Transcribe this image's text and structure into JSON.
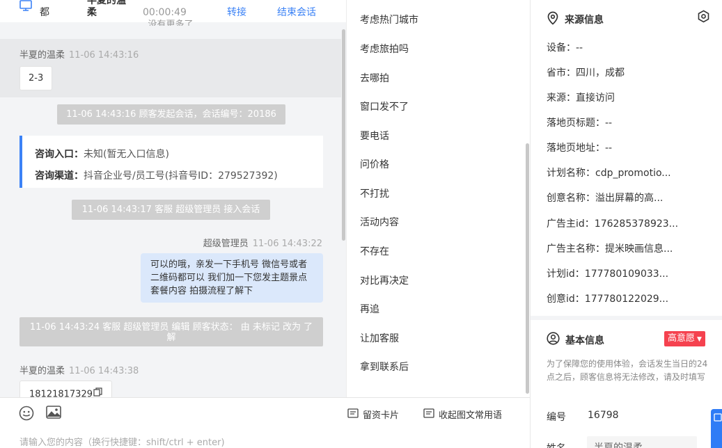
{
  "header": {
    "name_a": "都",
    "name_b_line1": "半夏的温",
    "name_b_line2": "柔",
    "timer": "00:00:49",
    "transfer_label": "转接",
    "end_label": "结束会话"
  },
  "chat": {
    "no_more": "没有更多了",
    "messages": [
      {
        "sender": "半夏的温柔",
        "time": "11-06 14:43:16",
        "text": "2-3"
      },
      {
        "sender": "半夏的温柔",
        "time": "11-06 14:43:38",
        "text": "18121817329"
      }
    ],
    "system": [
      "11-06 14:43:16 顾客发起会话，会话编号：20186",
      "11-06 14:43:17 客服 超级管理员 接入会话",
      "11-06 14:43:24 客服 超级管理员 编辑 顾客状态： 由 未标记 改为 了解"
    ],
    "info_card": {
      "entry_label": "咨询入口：",
      "entry_value": "未知(暂无入口信息)",
      "channel_label": "咨询渠道：",
      "channel_value": "抖音企业号/员工号(抖音号ID：279527392)"
    },
    "agent_reply": {
      "sender": "超级管理员",
      "time": "11-06 14:43:22",
      "text": "可以的哦，亲发一下手机号 微信号或者二维码都可以 我们加一下您发主题景点 套餐内容 拍摄流程了解下"
    }
  },
  "toolbar": {
    "card_label": "留资卡片",
    "collapse_label": "收起图文常用语",
    "input_placeholder": "请输入您的内容（换行快捷键：shift/ctrl + enter)"
  },
  "phrases": [
    "考虑热门城市",
    "考虑旅拍吗",
    "去哪拍",
    "窗口发不了",
    "要电话",
    "问价格",
    "不打扰",
    "活动内容",
    "不存在",
    "对比再决定",
    "再追",
    "让加客服",
    "拿到联系后"
  ],
  "source_info": {
    "title": "来源信息",
    "rows": [
      {
        "label": "设备：",
        "value": "--"
      },
      {
        "label": "省市：",
        "value": "四川，成都"
      },
      {
        "label": "来源：",
        "value": "直接访问"
      },
      {
        "label": "落地页标题：",
        "value": "--"
      },
      {
        "label": "落地页地址：",
        "value": "--"
      },
      {
        "label": "计划名称：",
        "value": "cdp_promotio..."
      },
      {
        "label": "创意名称：",
        "value": "溢出屏幕的高..."
      },
      {
        "label": "广告主id：",
        "value": "176285378923..."
      },
      {
        "label": "广告主名称：",
        "value": "提米映画信息..."
      },
      {
        "label": "计划id：",
        "value": "177780109033..."
      },
      {
        "label": "创意id：",
        "value": "177780122029..."
      }
    ]
  },
  "basic_info": {
    "title": "基本信息",
    "intent_tag": "高意愿",
    "note": "为了保障您的使用体验，会话发生当日的24点之后，顾客信息将无法修改，请及时填写",
    "id_label": "编号",
    "id_value": "16798",
    "name_label": "姓名",
    "name_value": "半夏的温柔"
  },
  "colors": {
    "accent": "#3b82f6",
    "tag_red": "#f5424f",
    "out_bubble": "#dbe8fb"
  }
}
